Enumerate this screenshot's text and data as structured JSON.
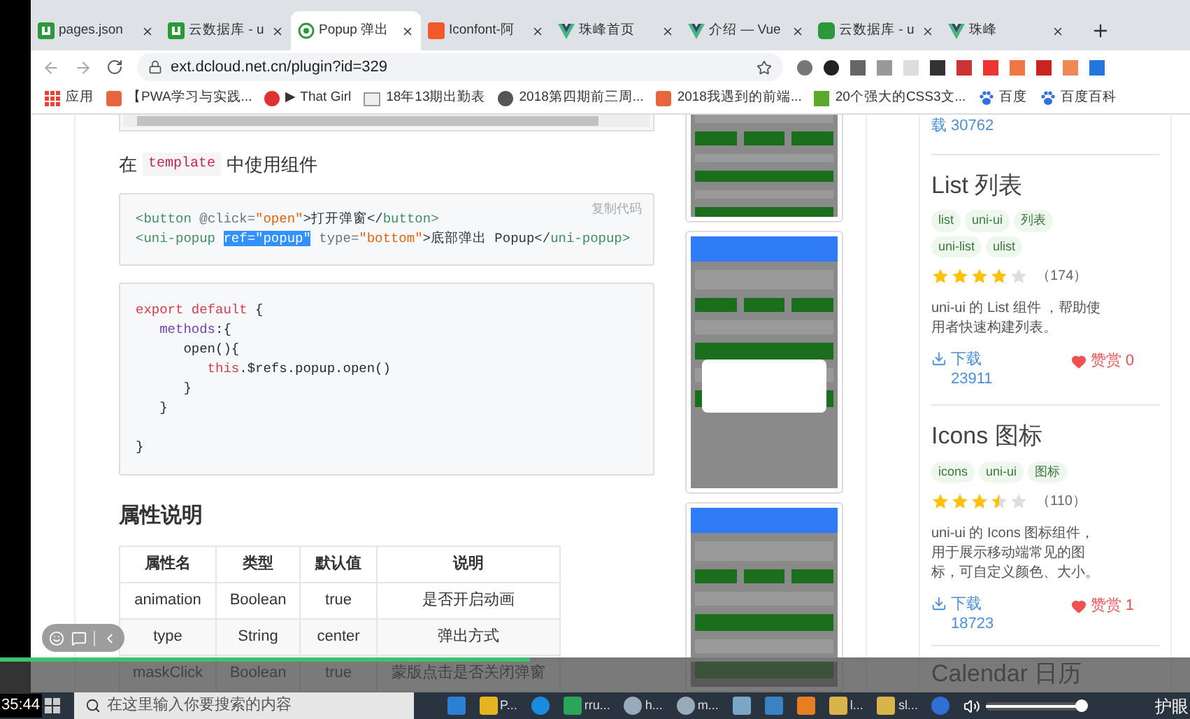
{
  "browser": {
    "tabs": [
      {
        "title": "pages.json",
        "kind": "u",
        "selected": false
      },
      {
        "title": "云数据库 - u",
        "kind": "u",
        "selected": false
      },
      {
        "title": "Popup 弹出",
        "kind": "plugin",
        "selected": true
      },
      {
        "title": "Iconfont-阿",
        "kind": "iconfont",
        "selected": false
      },
      {
        "title": "珠峰首页",
        "kind": "vue",
        "selected": false
      },
      {
        "title": "介绍 — Vue",
        "kind": "vue",
        "selected": false
      },
      {
        "title": "云数据库 - u",
        "kind": "cloud",
        "selected": false
      },
      {
        "title": "珠峰",
        "kind": "vue",
        "selected": false
      }
    ],
    "address": "ext.dcloud.net.cn/plugin?id=329",
    "bookmarks": [
      {
        "label": "应用",
        "kind": "apps"
      },
      {
        "label": "【PWA学习与实践...",
        "kind": "orange"
      },
      {
        "label": "▶ That Girl",
        "kind": "red"
      },
      {
        "label": "18年13期出勤表",
        "kind": "sheet"
      },
      {
        "label": "2018第四期前三周...",
        "kind": "globe"
      },
      {
        "label": "2018我遇到的前端...",
        "kind": "orange"
      },
      {
        "label": "20个强大的CSS3文...",
        "kind": "green"
      },
      {
        "label": "百度",
        "kind": "paw"
      },
      {
        "label": "百度百科",
        "kind": "paw"
      }
    ]
  },
  "article": {
    "intro": {
      "before": "在",
      "code": "template",
      "after": "中使用组件"
    },
    "code_blocks": [
      {
        "copy_label": "复制代码",
        "lines": [
          [
            {
              "text": "<button",
              "kind": "tag"
            },
            {
              "text": " @click=",
              "kind": "attr"
            },
            {
              "text": "\"open\"",
              "kind": "string"
            },
            {
              "text": ">打开弹窗</",
              "kind": "text"
            },
            {
              "text": "button>",
              "kind": "tag"
            }
          ],
          [
            {
              "text": "<uni-popup ",
              "kind": "tag"
            },
            {
              "text": "ref=\"popup\"",
              "kind": "selection"
            },
            {
              "text": " type=",
              "kind": "attr"
            },
            {
              "text": "\"bottom\"",
              "kind": "string"
            },
            {
              "text": ">底部弹出 Popup</",
              "kind": "text"
            },
            {
              "text": "uni-popup>",
              "kind": "tag"
            }
          ]
        ]
      },
      {
        "lines": [
          [
            {
              "text": "export default",
              "kind": "keyword"
            },
            {
              "text": " {",
              "kind": "plain"
            }
          ],
          [
            {
              "text": "   methods",
              "kind": "prop"
            },
            {
              "text": ":{",
              "kind": "plain"
            }
          ],
          [
            {
              "text": "      open(){",
              "kind": "plain"
            }
          ],
          [
            {
              "text": "         this",
              "kind": "keyword"
            },
            {
              "text": ".$refs.popup.open()",
              "kind": "plain"
            }
          ],
          [
            {
              "text": "      }",
              "kind": "plain"
            }
          ],
          [
            {
              "text": "   }",
              "kind": "plain"
            }
          ],
          [
            {
              "text": "}",
              "kind": "plain"
            }
          ]
        ]
      }
    ],
    "heading": "属性说明",
    "table": {
      "columns": [
        "属性名",
        "类型",
        "默认值",
        "说明"
      ],
      "rows": [
        [
          "animation",
          "Boolean",
          "true",
          "是否开启动画"
        ],
        [
          "type",
          "String",
          "center",
          "弹出方式"
        ],
        [
          "maskClick",
          "Boolean",
          "true",
          "蒙版点击是否关闭弹窗"
        ]
      ]
    }
  },
  "sidebar": {
    "top_download": "载 30762",
    "cards": [
      {
        "title": "List 列表",
        "tags": [
          "list",
          "uni-ui",
          "列表",
          "uni-list",
          "ulist"
        ],
        "stars": 4,
        "count": "（174）",
        "description": "uni-ui 的 List 组件 ，帮助使用者快速构建列表。",
        "downloads": "下载 23911",
        "tips": "赞赏 0"
      },
      {
        "title": "Icons 图标",
        "tags": [
          "icons",
          "uni-ui",
          "图标"
        ],
        "stars": 3.5,
        "count": "（110）",
        "description": "uni-ui 的 Icons 图标组件，用于展示移动端常见的图标，可自定义颜色、大小。",
        "downloads": "下载 18723",
        "tips": "赞赏 1"
      }
    ],
    "next_title": "Calendar 日历"
  },
  "player": {
    "progress": {
      "level": 0.445
    },
    "time": "35:44"
  },
  "taskbar": {
    "placeholder": "在这里输入你要搜索的内容",
    "apps": [
      {
        "kind": "code"
      },
      {
        "kind": "chrome",
        "label": "P..."
      },
      {
        "kind": "circle"
      },
      {
        "kind": "h",
        "label": "rru..."
      },
      {
        "kind": "face",
        "label": "h..."
      },
      {
        "kind": "face",
        "label": "m..."
      },
      {
        "kind": "pen"
      },
      {
        "kind": "cloud"
      },
      {
        "kind": "scissors"
      },
      {
        "kind": "folder",
        "label": "l..."
      },
      {
        "kind": "folder",
        "label": "sl..."
      },
      {
        "kind": "help"
      }
    ],
    "eye_care": "护眼",
    "volume": {
      "level": 1
    }
  }
}
